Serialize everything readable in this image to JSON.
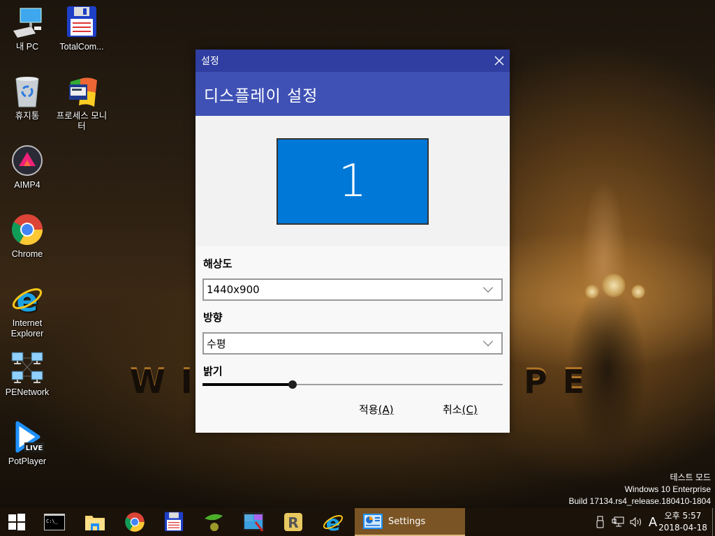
{
  "desktop": {
    "icons": [
      {
        "id": "this-pc",
        "label": "내 PC",
        "icon": "computer-icon"
      },
      {
        "id": "total-commander",
        "label": "TotalCom...",
        "icon": "floppy-disk-icon"
      },
      {
        "id": "recycle-bin",
        "label": "휴지통",
        "icon": "recycle-bin-icon"
      },
      {
        "id": "process-monitor",
        "label": "프로세스 모니터",
        "icon": "process-monitor-icon"
      },
      {
        "id": "aimp4",
        "label": "AIMP4",
        "icon": "aimp-icon"
      },
      {
        "id": "chrome",
        "label": "Chrome",
        "icon": "chrome-icon"
      },
      {
        "id": "internet-explorer",
        "label": "Internet Explorer",
        "icon": "internet-explorer-icon"
      },
      {
        "id": "penetwork",
        "label": "PENetwork",
        "icon": "network-icon"
      },
      {
        "id": "potplayer",
        "label": "PotPlayer",
        "icon": "potplayer-icon",
        "badge": "LIVE"
      }
    ]
  },
  "dialog": {
    "window_title": "설정",
    "close_icon": "close-icon",
    "header": "디스플레이 설정",
    "monitor_number": "1",
    "resolution": {
      "label": "해상도",
      "value": "1440x900"
    },
    "orientation": {
      "label": "방향",
      "value": "수평"
    },
    "brightness": {
      "label": "밝기",
      "value_percent": 30
    },
    "buttons": {
      "apply": {
        "text": "적용",
        "accel": "(A)"
      },
      "cancel": {
        "text": "취소",
        "accel": "(C)"
      }
    },
    "colors": {
      "titlebar": "#2f3ea0",
      "header": "#3f51b5",
      "monitor": "#0078d7"
    }
  },
  "watermark": {
    "line1": "테스트 모드",
    "line2": "Windows 10 Enterprise",
    "line3": "Build 17134.rs4_release.180410-1804"
  },
  "taskbar": {
    "items": [
      {
        "id": "start",
        "icon": "windows-start-icon"
      },
      {
        "id": "cmd",
        "icon": "command-prompt-icon"
      },
      {
        "id": "explorer",
        "icon": "file-explorer-icon"
      },
      {
        "id": "chrome",
        "icon": "chrome-icon"
      },
      {
        "id": "total-commander",
        "icon": "floppy-disk-icon"
      },
      {
        "id": "olive",
        "icon": "olive-leaf-icon"
      },
      {
        "id": "paint",
        "icon": "paint-icon"
      },
      {
        "id": "r-app",
        "icon": "r-app-icon"
      },
      {
        "id": "ie",
        "icon": "internet-explorer-icon"
      }
    ],
    "active_window": {
      "label": "Settings",
      "icon": "settings-window-icon"
    },
    "tray": {
      "icons": [
        "usb-icon",
        "network-icon",
        "volume-icon"
      ],
      "ime": "A",
      "time": "오후 5:57",
      "date": "2018-04-18"
    }
  }
}
